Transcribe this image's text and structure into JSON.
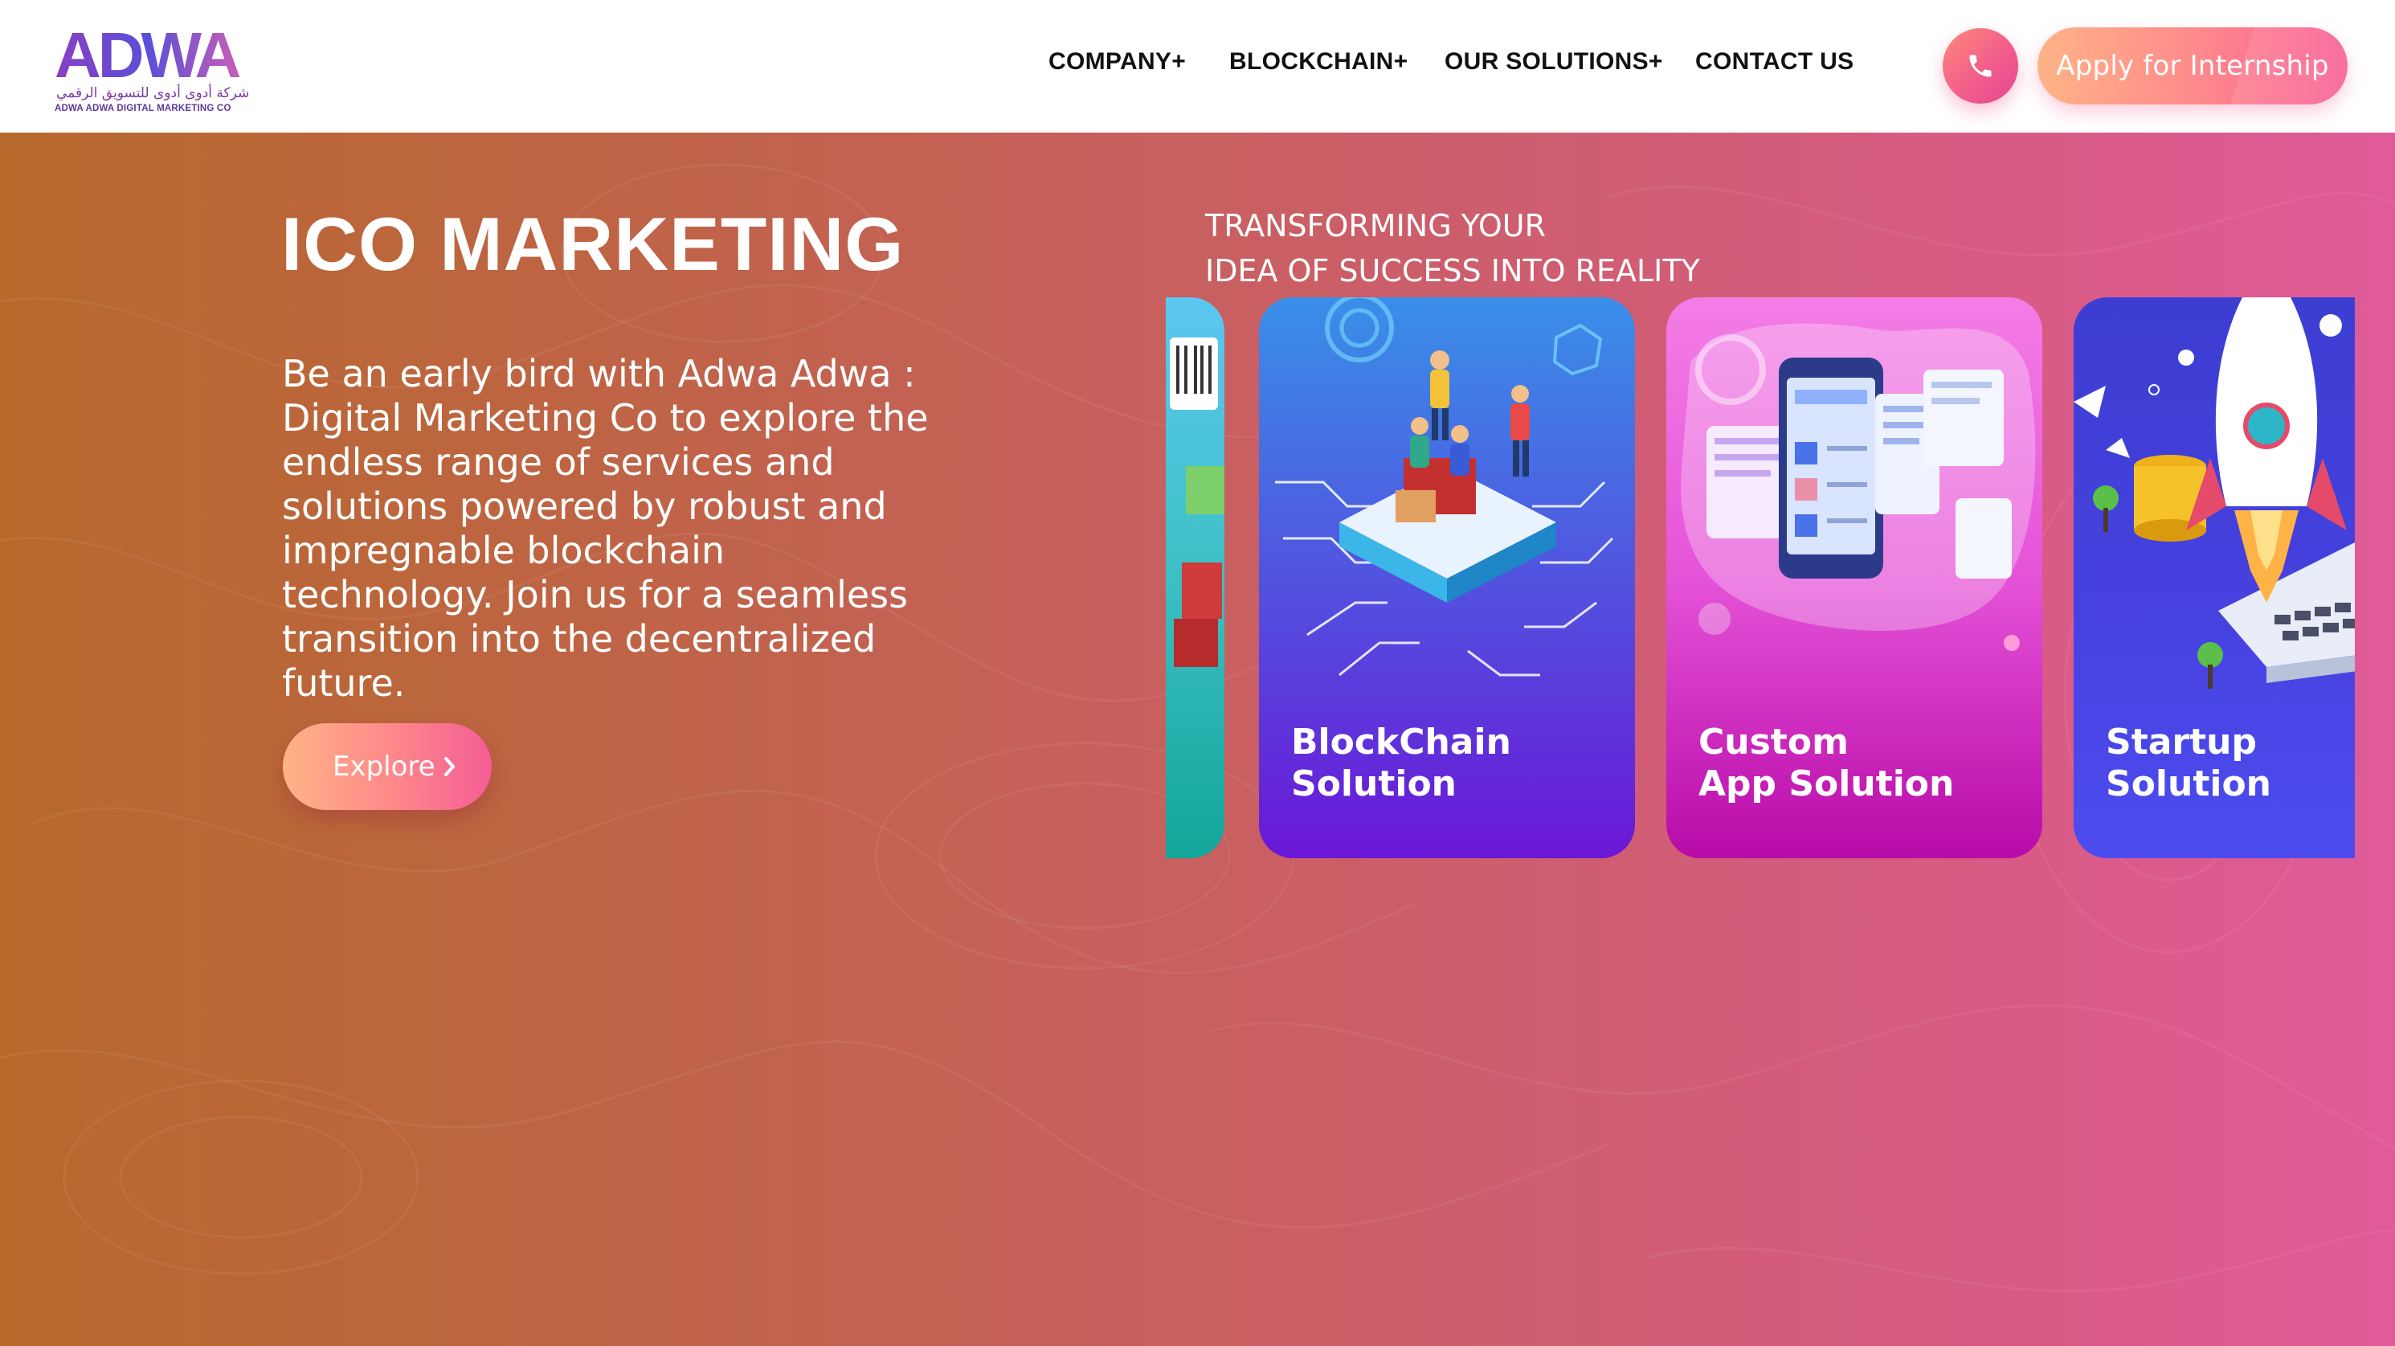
{
  "header": {
    "logo": {
      "wordmark": "ADWA",
      "arabic_text": "شركة أدوى أدوى للتسويق الرقمي",
      "english_text": "ADWA ADWA DIGITAL MARKETING CO"
    },
    "nav": [
      {
        "label": "COMPANY+"
      },
      {
        "label": "BLOCKCHAIN+"
      },
      {
        "label": "OUR SOLUTIONS+"
      },
      {
        "label": "CONTACT US"
      }
    ],
    "phone_icon": "phone-icon",
    "apply_label": "Apply for Internship"
  },
  "hero": {
    "title": "ICO MARKETING",
    "description": "Be an early bird with Adwa Adwa : Digital Marketing Co to explore the endless range of services and solutions powered by robust and impregnable blockchain technology. Join us for a seamless transition into the decentralized future.",
    "tagline": [
      "TRANSFORMING YOUR",
      "IDEA OF SUCCESS INTO REALITY"
    ],
    "explore_label": "Explore",
    "explore_icon": "chevron-right-icon"
  },
  "carousel": {
    "cards": [
      {
        "title_line1": "",
        "title_line2": ""
      },
      {
        "title_line1": "BlockChain",
        "title_line2": "Solution"
      },
      {
        "title_line1": "Custom",
        "title_line2": "App Solution"
      },
      {
        "title_line1": "Startup",
        "title_line2": "Solution"
      }
    ]
  },
  "colors": {
    "hero_gradient_start": "#b7692c",
    "hero_gradient_end": "#e05b98",
    "accent_pink": "#f05a8c",
    "accent_peach": "#ffb387",
    "nav_text": "#111111"
  }
}
